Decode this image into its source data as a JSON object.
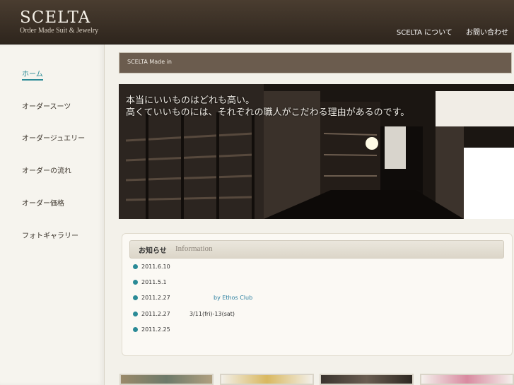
{
  "brand": {
    "title": "SCELTA",
    "subtitle": "Order Made Suit & Jewelry"
  },
  "topnav": [
    "SCELTA について",
    "お問い合わせ"
  ],
  "sidebar": [
    {
      "label": "ホーム",
      "active": true
    },
    {
      "label": "オーダースーツ"
    },
    {
      "label": "オーダージュエリー"
    },
    {
      "label": "オーダーの流れ"
    },
    {
      "label": "オーダー価格"
    },
    {
      "label": "フォトギャラリー"
    }
  ],
  "breadcrumb": "SCELTA Made in",
  "hero": {
    "line1": "本当にいいものはどれも高い。",
    "line2": "高くていいものには、それぞれの職人がこだわる理由があるのです。"
  },
  "news": {
    "title": "お知らせ",
    "subtitle": "Information",
    "items": [
      {
        "date": "2011.6.10",
        "text": ""
      },
      {
        "date": "2011.5.1",
        "text": ""
      },
      {
        "date": "2011.2.27",
        "text": "by Ethos Club",
        "link": true
      },
      {
        "date": "2011.2.27",
        "text": "3/11(fri)-13(sat)"
      },
      {
        "date": "2011.2.25",
        "text": ""
      }
    ]
  },
  "colors": {
    "accent": "#2a8a96",
    "header": "#3b3027",
    "breadcrumb_bg": "#6b5c4e"
  }
}
